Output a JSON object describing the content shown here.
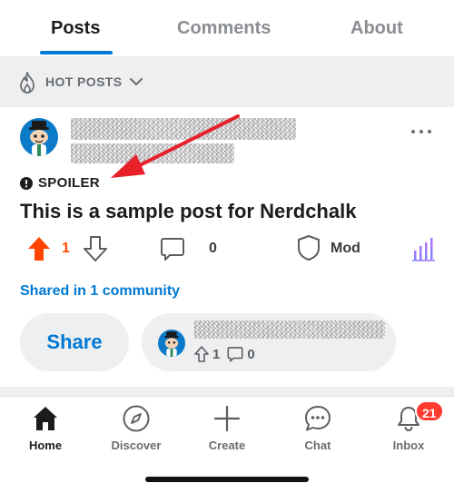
{
  "tabs": [
    {
      "label": "Posts",
      "active": true
    },
    {
      "label": "Comments",
      "active": false
    },
    {
      "label": "About",
      "active": false
    }
  ],
  "sort": {
    "label": "HOT POSTS",
    "icon": "flame-icon"
  },
  "post": {
    "spoiler_label": "SPOILER",
    "title": "This is a sample post for Nerdchalk",
    "upvotes": "1",
    "comments": "0",
    "mod_label": "Mod",
    "shared_text": "Shared in 1 community",
    "share_label": "Share",
    "crosspost": {
      "upvotes": "1",
      "comments": "0"
    }
  },
  "bottom_nav": [
    {
      "label": "Home",
      "icon": "home-icon",
      "active": true
    },
    {
      "label": "Discover",
      "icon": "compass-icon",
      "active": false
    },
    {
      "label": "Create",
      "icon": "plus-icon",
      "active": false
    },
    {
      "label": "Chat",
      "icon": "chat-bubble-icon",
      "active": false
    },
    {
      "label": "Inbox",
      "icon": "bell-icon",
      "active": false,
      "badge": "21"
    }
  ],
  "colors": {
    "accent": "#0079d3",
    "upvote": "#ff4500",
    "annotation_arrow": "#e8202a",
    "badge": "#ff3b30"
  }
}
